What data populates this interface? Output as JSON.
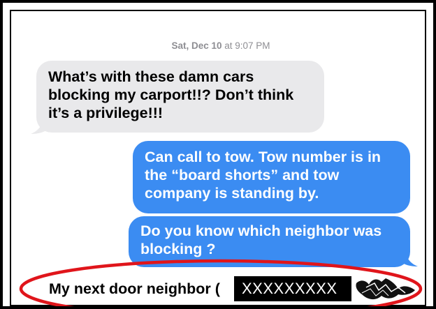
{
  "timestamp": {
    "day": "Sat, Dec 10",
    "time": "at 9:07 PM"
  },
  "messages": [
    {
      "direction": "incoming",
      "text": "What’s with these damn cars\nblocking my carport!!? Don’t think\nit’s a privilege!!!"
    },
    {
      "direction": "outgoing",
      "text": "Can call to tow.  Tow number is in\nthe “board shorts” and tow\ncompany is standing by."
    },
    {
      "direction": "outgoing",
      "text": "Do you know which neighbor was\nblocking ?"
    },
    {
      "direction": "incoming",
      "text": "My next door neighbor ("
    }
  ],
  "redaction": {
    "label": "XXXXXXXXX"
  },
  "colors": {
    "incoming_bubble": "#e9e9eb",
    "outgoing_bubble": "#3b8cf2",
    "highlight_ellipse": "#e0151b"
  }
}
